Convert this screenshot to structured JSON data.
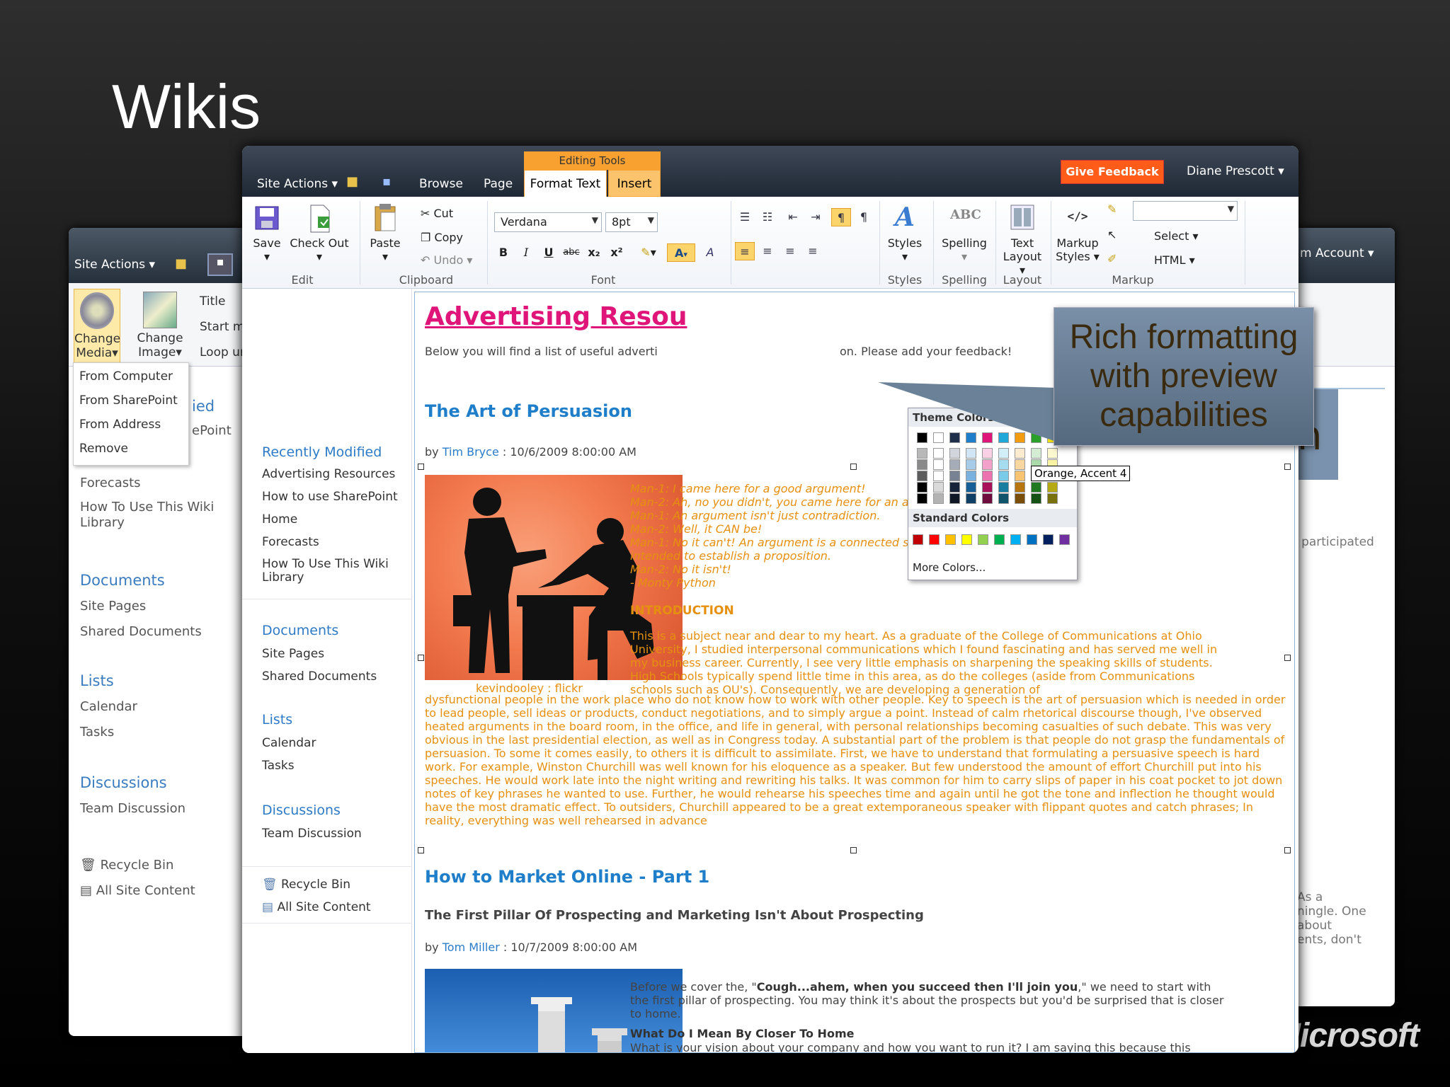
{
  "slide": {
    "title": "Wikis",
    "logo": "Microsoft"
  },
  "back_left": {
    "site_actions": "Site Actions",
    "btn_change_media": "Change Media",
    "btn_change_image": "Change Image",
    "ribbon_text": [
      "Title",
      "Start me",
      "Loop un"
    ],
    "dropdown": [
      "From Computer",
      "From SharePoint",
      "From Address",
      "Remove"
    ],
    "frag_ied": "ied",
    "frag_epoint": "ePoint",
    "nav": [
      "Forecasts",
      "How To Use This Wiki Library"
    ],
    "documents_header": "Documents",
    "documents": [
      "Site Pages",
      "Shared Documents"
    ],
    "lists_header": "Lists",
    "lists": [
      "Calendar",
      "Tasks"
    ],
    "discussions_header": "Discussions",
    "discussions": [
      "Team Discussion"
    ],
    "recycle": "Recycle Bin",
    "all_content": "All Site Content"
  },
  "back_right": {
    "account": "m Account",
    "frag_n": "n",
    "frag_participated": "t participated",
    "frag_lines": [
      "As a",
      "ningle. One",
      "about",
      "ents, don't"
    ]
  },
  "main": {
    "site_actions": "Site Actions",
    "tabs": {
      "browse": "Browse",
      "page": "Page",
      "context_group": "Editing Tools",
      "format_text": "Format Text",
      "insert": "Insert"
    },
    "feedback": "Give Feedback",
    "user": "Diane Prescott",
    "ribbon": {
      "save": "Save",
      "check_out": "Check Out",
      "paste": "Paste",
      "cut": "Cut",
      "copy": "Copy",
      "undo": "Undo",
      "font_name": "Verdana",
      "font_size": "8pt",
      "styles": "Styles",
      "spelling": "Spelling",
      "spelling_icon": "ABC",
      "text_layout": "Text Layout",
      "markup_styles": "Markup Styles",
      "select": "Select",
      "html": "HTML",
      "groups": {
        "edit": "Edit",
        "clipboard": "Clipboard",
        "font": "Font",
        "styles": "Styles",
        "spelling": "Spelling",
        "layout": "Layout",
        "markup": "Markup"
      }
    },
    "leftnav": {
      "recent_header": "Recently Modified",
      "recent": [
        "Advertising Resources",
        "How to use SharePoint",
        "Home",
        "Forecasts",
        "How To Use This Wiki Library"
      ],
      "documents_header": "Documents",
      "documents": [
        "Site Pages",
        "Shared Documents"
      ],
      "lists_header": "Lists",
      "lists": [
        "Calendar",
        "Tasks"
      ],
      "discussions_header": "Discussions",
      "discussions": [
        "Team Discussion"
      ],
      "recycle": "Recycle Bin",
      "all_content": "All Site Content"
    },
    "content": {
      "title": "Advertising Resou",
      "intro_a": "Below you will find a list of useful adverti",
      "intro_b": "on.  Please add your feedback!",
      "article1": {
        "title": "The Art of Persuasion",
        "by": "by",
        "author": "Tim Bryce",
        "date": " : 10/6/2009 8:00:00 AM",
        "img_caption": "kevindooley : flickr",
        "quotes": [
          "Man-1: I came here for a good argument!",
          "Man-2: Ah, no you didn't, you came here for an argument!",
          "Man-1: An argument isn't just contradiction.",
          "Man-2: Well, it CAN be!",
          "Man-1: No it can't! An argument is a connected series of statements",
          "intended to establish a proposition.",
          "Man-2: No it isn't!",
          "- Monty Python"
        ],
        "intro_heading": "INTRODUCTION",
        "body1": "This is a subject near and dear to my heart. As a graduate of the College of Communications at Ohio University, I studied interpersonal communications which I found fascinating and has served me well in my business career. Currently, I see very little emphasis on sharpening the speaking skills of students. High Schools typically spend little time in this area, as do the colleges (aside from Communications schools such as OU's). Consequently, we are developing a generation of",
        "body2": "dysfunctional people in the work place who do not know how to work with other people. Key to speech is the art of persuasion which is needed in order to lead people, sell ideas or products, conduct negotiations, and to simply argue a point. Instead of calm rhetorical discourse though, I've observed heated arguments in the board room, in the office, and life in general, with personal relationships becoming casualties of such debate. This was very obvious in the last presidential election, as well as in Congress today. A substantial part of the problem is that people do not grasp the fundamentals of persuasion. To some it comes easily, to others it is difficult to assimilate. First, we have to understand that formulating a persuasive speech is hard work. For example, Winston Churchill was well known for his eloquence as a speaker. But few understood the amount of effort Churchill put into his speeches. He would work late into the night writing and rewriting his talks. It was  common for him to carry slips of paper in his coat pocket to jot down notes of key phrases he wanted to use. Further, he would rehearse his speeches time and again until he got the tone and inflection he thought would have the most dramatic effect. To outsiders, Churchill appeared to be a great extemporaneous speaker with flippant quotes and catch phrases; In reality, everything was well rehearsed in advance"
      },
      "article2": {
        "title": "How to Market Online - Part 1",
        "subtitle": "The First Pillar Of Prospecting and Marketing Isn't About Prospecting",
        "by": "by",
        "author": "Tom Miller",
        "date": " : 10/7/2009 8:00:00 AM",
        "p1_a": "Before we cover the, \"",
        "p1_b": "Cough...ahem, when you succeed then I'll join you",
        "p1_c": ",\" we need to start with the first pillar of prospecting. You may think it's about the prospects but you'd be surprised that is closer to home.",
        "p2_heading": "What Do I Mean By Closer To Home",
        "p2": "What is your vision about your company and how you want to run it? I am saying this because this"
      }
    },
    "color_popup": {
      "theme_header": "Theme Colors",
      "standard_header": "Standard Colors",
      "more": "More Colors...",
      "tooltip": "Orange, Accent 4",
      "theme_row": [
        "#000000",
        "#ffffff",
        "#1f2f4a",
        "#1f7ec9",
        "#e0157a",
        "#1fa8d8",
        "#f39c12",
        "#2aa02a",
        "#f1e21a"
      ],
      "standard_row": [
        "#c00000",
        "#ff0000",
        "#ffc000",
        "#ffff00",
        "#92d050",
        "#00b050",
        "#00b0f0",
        "#0070c0",
        "#002060",
        "#7030a0"
      ]
    },
    "callout": "Rich formatting with preview capabilities"
  }
}
